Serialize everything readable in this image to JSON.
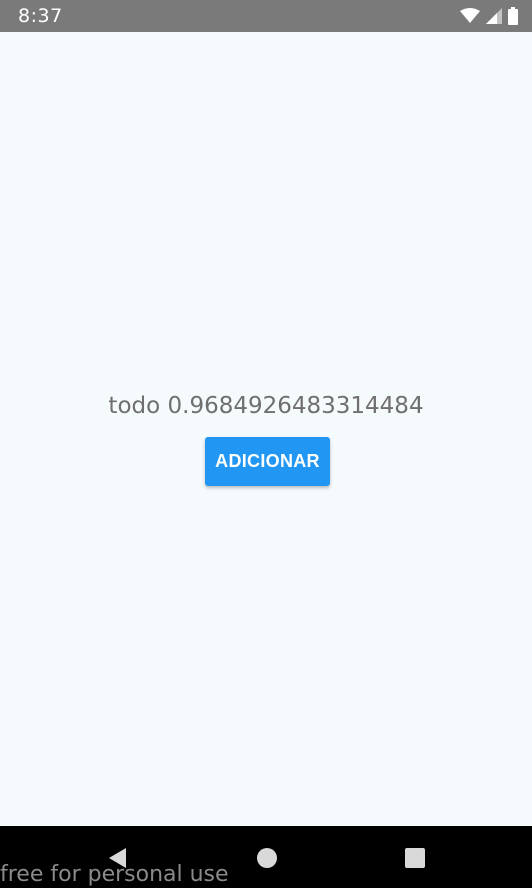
{
  "status_bar": {
    "time": "8:37",
    "icons": [
      "wifi-icon",
      "signal-icon",
      "battery-icon"
    ]
  },
  "main": {
    "todo_text": "todo 0.9684926483314484",
    "add_button_label": "ADICIONAR"
  },
  "nav_bar": {
    "buttons": [
      "back-icon",
      "home-icon",
      "recent-apps-icon"
    ]
  },
  "watermark": "free for personal use",
  "colors": {
    "accent": "#2196f3",
    "background": "#f5fafd",
    "status_bar": "#7a7a7a",
    "nav_bar": "#000000"
  }
}
